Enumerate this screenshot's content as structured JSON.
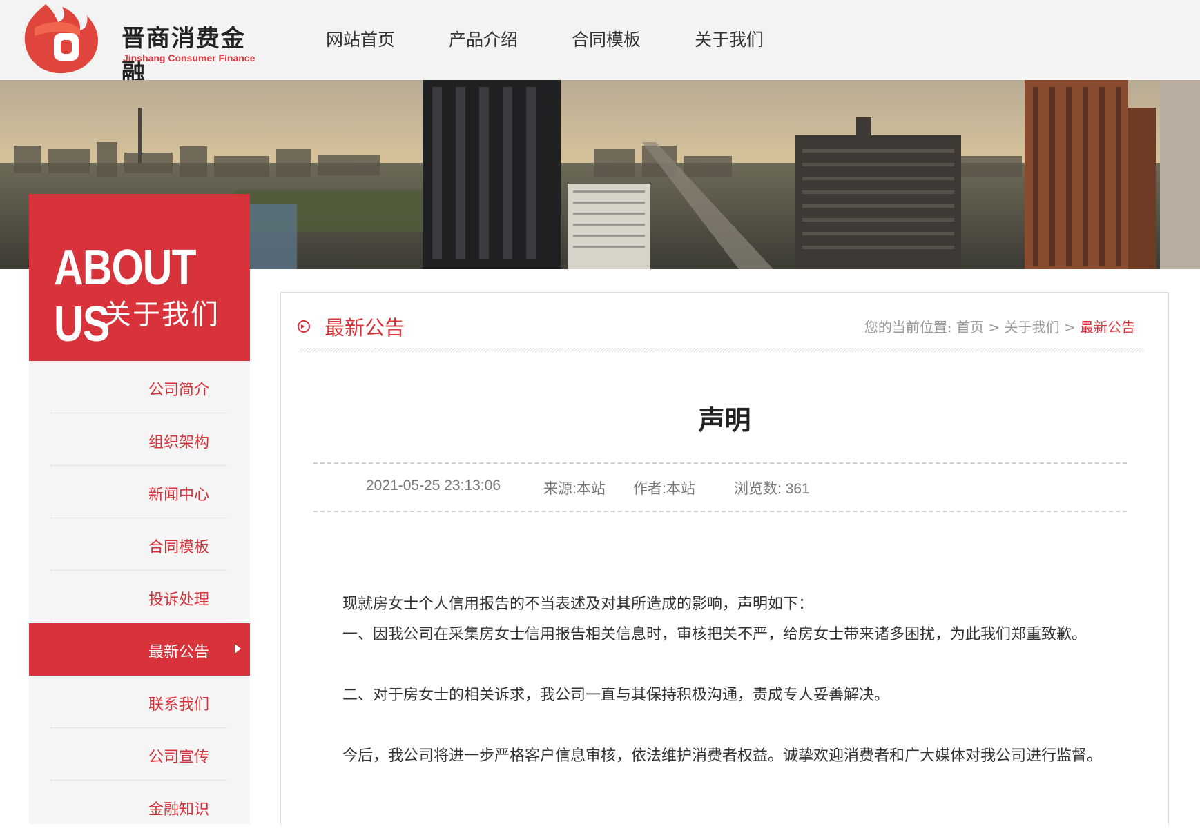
{
  "brand": {
    "name_cn": "晋商消费金融",
    "name_en": "Jinshang Consumer Finance",
    "color": "#d8323a"
  },
  "nav": {
    "items": [
      "网站首页",
      "产品介绍",
      "合同模板",
      "关于我们"
    ]
  },
  "sidebar": {
    "hero_en": "ABOUT US",
    "hero_cn": "关于我们",
    "items": [
      {
        "label": "公司简介"
      },
      {
        "label": "组织架构"
      },
      {
        "label": "新闻中心"
      },
      {
        "label": "合同模板"
      },
      {
        "label": "投诉处理"
      },
      {
        "label": "最新公告",
        "active": true
      },
      {
        "label": "联系我们"
      },
      {
        "label": "公司宣传"
      },
      {
        "label": "金融知识"
      }
    ]
  },
  "section": {
    "title": "最新公告",
    "breadcrumb": {
      "prefix": "您的当前位置:",
      "items": [
        "首页",
        "关于我们",
        "最新公告"
      ],
      "separator": ">"
    }
  },
  "article": {
    "title": "声明",
    "date": "2021-05-25 23:13:06",
    "source": "来源:本站",
    "author": "作者:本站",
    "views_label": "浏览数:",
    "views": "361",
    "p1": "现就房女士个人信用报告的不当表述及对其所造成的影响，声明如下：",
    "p2": "一、因我公司在采集房女士信用报告相关信息时，审核把关不严，给房女士带来诸多困扰，为此我们郑重致歉。",
    "p3": "二、对于房女士的相关诉求，我公司一直与其保持积极沟通，责成专人妥善解决。",
    "p4": "今后，我公司将进一步严格客户信息审核，依法维护消费者权益。诚挚欢迎消费者和广大媒体对我公司进行监督。"
  }
}
